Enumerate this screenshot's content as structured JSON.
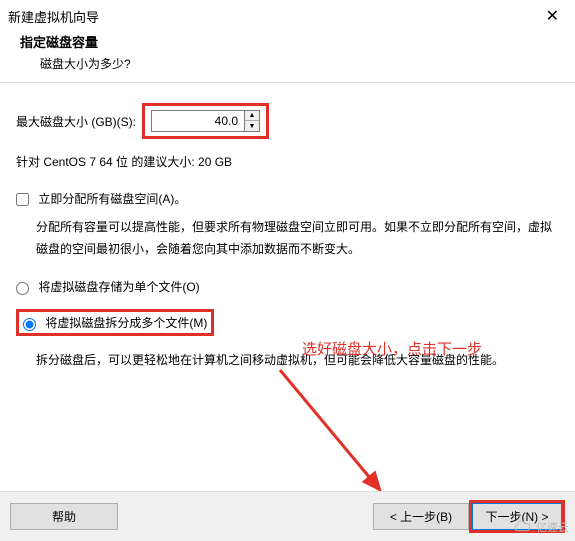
{
  "title": "新建虚拟机向导",
  "header": {
    "title": "指定磁盘容量",
    "sub": "磁盘大小为多少?"
  },
  "size": {
    "label": "最大磁盘大小 (GB)(S):",
    "value": "40.0"
  },
  "recommend": "针对 CentOS 7 64 位 的建议大小: 20 GB",
  "allocate": {
    "label": "立即分配所有磁盘空间(A)。",
    "desc": "分配所有容量可以提高性能，但要求所有物理磁盘空间立即可用。如果不立即分配所有空间，虚拟磁盘的空间最初很小，会随着您向其中添加数据而不断变大。"
  },
  "radios": {
    "single": "将虚拟磁盘存储为单个文件(O)",
    "split": "将虚拟磁盘拆分成多个文件(M)",
    "splitdesc": "拆分磁盘后，可以更轻松地在计算机之间移动虚拟机，但可能会降低大容量磁盘的性能。"
  },
  "annotation": "选好磁盘大小，点击下一步",
  "buttons": {
    "help": "帮助",
    "prev": "< 上一步(B)",
    "next": "下一步(N) >"
  },
  "watermark": "亿速云"
}
